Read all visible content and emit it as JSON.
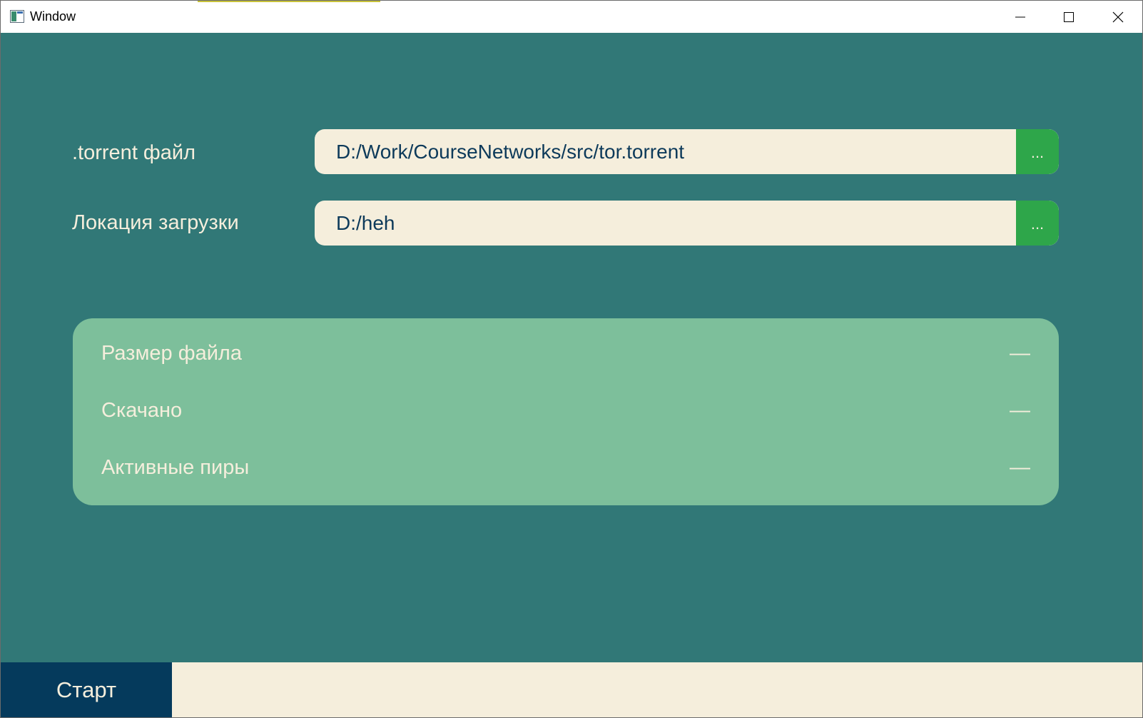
{
  "window": {
    "title": "Window",
    "colors": {
      "background": "#317877",
      "accent_green": "#2ea64a",
      "panel": "#7dbf9b",
      "field": "#f5eedc",
      "start_button": "#053a5c"
    }
  },
  "titlebar": {
    "icons": {
      "app": "app-window-icon",
      "minimize": "minimize-icon",
      "maximize": "maximize-icon",
      "close": "close-icon"
    }
  },
  "form": {
    "torrent": {
      "label": ".torrent файл",
      "value": "D:/Work/CourseNetworks/src/tor.torrent",
      "browse_label": "..."
    },
    "location": {
      "label": "Локация загрузки",
      "value": "D:/heh",
      "browse_label": "..."
    }
  },
  "info": {
    "rows": [
      {
        "label": "Размер файла",
        "value": "—"
      },
      {
        "label": "Скачано",
        "value": "—"
      },
      {
        "label": "Активные пиры",
        "value": "—"
      }
    ]
  },
  "footer": {
    "start_label": "Старт",
    "status_text": ""
  }
}
